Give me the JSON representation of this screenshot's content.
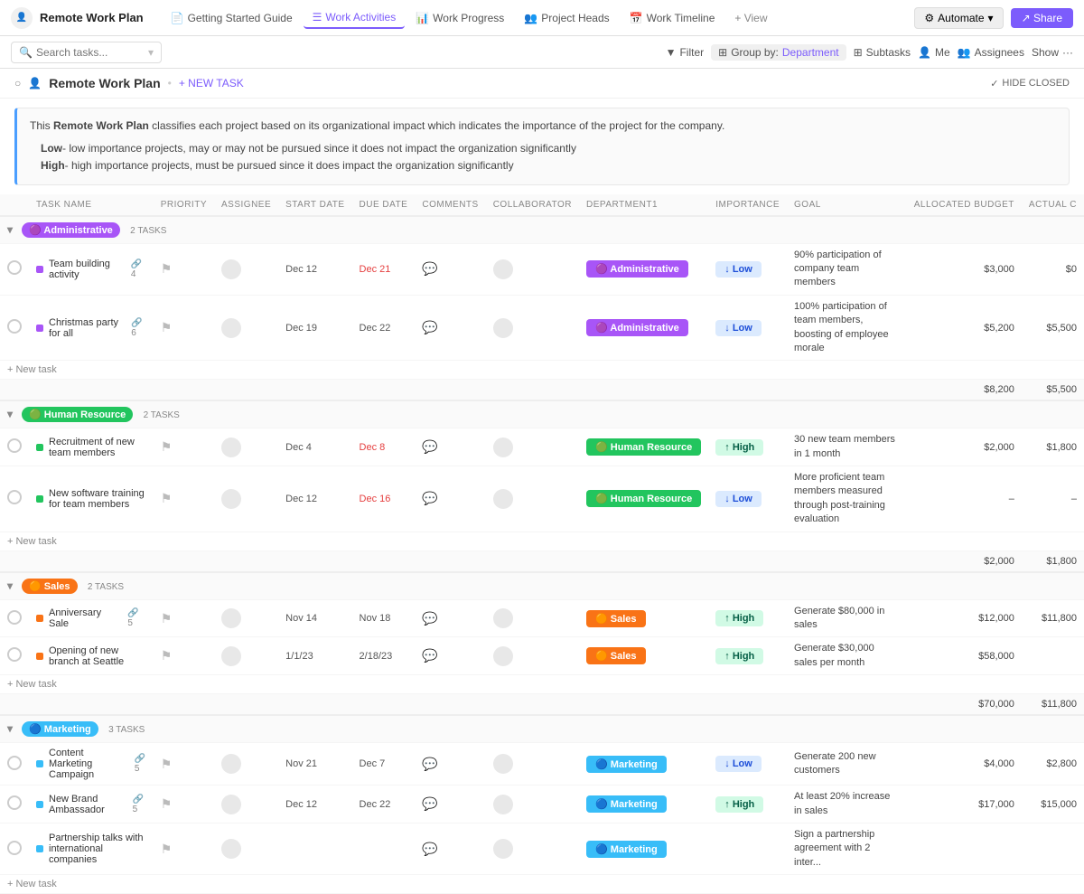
{
  "topBar": {
    "logo": "👤",
    "projectName": "Remote Work Plan",
    "navItems": [
      {
        "id": "getting-started",
        "label": "Getting Started Guide",
        "icon": "📄",
        "active": false
      },
      {
        "id": "work-activities",
        "label": "Work Activities",
        "icon": "☰",
        "active": true
      },
      {
        "id": "work-progress",
        "label": "Work Progress",
        "icon": "📊",
        "active": false
      },
      {
        "id": "project-heads",
        "label": "Project Heads",
        "icon": "👥",
        "active": false
      },
      {
        "id": "work-timeline",
        "label": "Work Timeline",
        "icon": "📅",
        "active": false
      },
      {
        "id": "view",
        "label": "+ View",
        "icon": "",
        "active": false
      }
    ],
    "automate": "Automate",
    "share": "Share"
  },
  "secondBar": {
    "searchPlaceholder": "Search tasks...",
    "filterLabel": "Filter",
    "groupByLabel": "Group by:",
    "groupByValue": "Department",
    "subtasksLabel": "Subtasks",
    "meLabel": "Me",
    "assigneesLabel": "Assignees",
    "showLabel": "Show"
  },
  "projectHeader": {
    "icon": "👤",
    "title": "Remote Work Plan",
    "newTask": "+ NEW TASK",
    "hideClosedCheck": "✓",
    "hideClosed": "HIDE CLOSED"
  },
  "infoBox": {
    "intro": "This ",
    "boldName": "Remote Work Plan",
    "introRest": " classifies each project based on its organizational impact which indicates the importance of the project for the company.",
    "bullets": [
      {
        "label": "Low",
        "text": "- low importance projects, may or may not be pursued since it does not impact the organization significantly"
      },
      {
        "label": "High",
        "text": "- high importance projects, must be pursued since it does impact the organization significantly"
      }
    ]
  },
  "columns": [
    "",
    "TASK NAME",
    "PRIORITY",
    "ASSIGNEE",
    "START DATE",
    "DUE DATE",
    "COMMENTS",
    "COLLABORATOR",
    "DEPARTMENT1",
    "IMPORTANCE",
    "GOAL",
    "ALLOCATED BUDGET",
    "ACTUAL C"
  ],
  "groups": [
    {
      "id": "administrative",
      "label": "Administrative",
      "badgeClass": "badge-admin",
      "taskCount": "2 TASKS",
      "dotClass": "dot-admin",
      "deptBadgeClass": "dept-admin-bg",
      "deptLabel": "Administrative",
      "tasks": [
        {
          "name": "Team building activity",
          "links": 4,
          "priority": "⚑",
          "startDate": "Dec 12",
          "dueDate": "Dec 21",
          "dueDateClass": "date-red",
          "department": "Administrative",
          "importance": "Low",
          "impClass": "imp-low",
          "goal": "90% participation of company team members",
          "budget": "$3,000",
          "actual": "$0"
        },
        {
          "name": "Christmas party for all",
          "links": 6,
          "priority": "⚑",
          "startDate": "Dec 19",
          "dueDate": "Dec 22",
          "dueDateClass": "date-normal",
          "department": "Administrative",
          "importance": "Low",
          "impClass": "imp-low",
          "goal": "100% participation of team members, boosting of employee morale",
          "budget": "$5,200",
          "actual": "$5,500"
        }
      ],
      "totalBudget": "$8,200",
      "totalActual": "$5,500"
    },
    {
      "id": "human-resource",
      "label": "Human Resource",
      "badgeClass": "badge-hr",
      "taskCount": "2 TASKS",
      "dotClass": "dot-hr",
      "deptBadgeClass": "dept-hr-bg",
      "deptLabel": "Human Resource",
      "tasks": [
        {
          "name": "Recruitment of new team members",
          "links": null,
          "priority": "⚑",
          "startDate": "Dec 4",
          "dueDate": "Dec 8",
          "dueDateClass": "date-red",
          "department": "Human Resource",
          "importance": "High",
          "impClass": "imp-high",
          "goal": "30 new team members in 1 month",
          "budget": "$2,000",
          "actual": "$1,800"
        },
        {
          "name": "New software training for team members",
          "links": null,
          "priority": "⚑",
          "startDate": "Dec 12",
          "dueDate": "Dec 16",
          "dueDateClass": "date-red",
          "department": "Human Resource",
          "importance": "Low",
          "impClass": "imp-low",
          "goal": "More proficient team members measured through post-training evaluation",
          "budget": "–",
          "actual": "–"
        }
      ],
      "totalBudget": "$2,000",
      "totalActual": "$1,800"
    },
    {
      "id": "sales",
      "label": "Sales",
      "badgeClass": "badge-sales",
      "taskCount": "2 TASKS",
      "dotClass": "dot-sales",
      "deptBadgeClass": "dept-sales-bg",
      "deptLabel": "Sales",
      "tasks": [
        {
          "name": "Anniversary Sale",
          "links": 5,
          "priority": "⚑",
          "startDate": "Nov 14",
          "dueDate": "Nov 18",
          "dueDateClass": "date-normal",
          "department": "Sales",
          "importance": "High",
          "impClass": "imp-high",
          "goal": "Generate $80,000 in sales",
          "budget": "$12,000",
          "actual": "$11,800"
        },
        {
          "name": "Opening of new branch at Seattle",
          "links": null,
          "priority": "⚑",
          "startDate": "1/1/23",
          "dueDate": "2/18/23",
          "dueDateClass": "date-normal",
          "department": "Sales",
          "importance": "High",
          "impClass": "imp-high",
          "goal": "Generate $30,000 sales per month",
          "budget": "$58,000",
          "actual": ""
        }
      ],
      "totalBudget": "$70,000",
      "totalActual": "$11,800"
    },
    {
      "id": "marketing",
      "label": "Marketing",
      "badgeClass": "badge-marketing",
      "taskCount": "3 TASKS",
      "dotClass": "dot-mkt",
      "deptBadgeClass": "dept-mkt-bg",
      "deptLabel": "Marketing",
      "tasks": [
        {
          "name": "Content Marketing Campaign",
          "links": 5,
          "priority": "⚑",
          "startDate": "Nov 21",
          "dueDate": "Dec 7",
          "dueDateClass": "date-normal",
          "department": "Marketing",
          "importance": "Low",
          "impClass": "imp-low",
          "goal": "Generate 200 new customers",
          "budget": "$4,000",
          "actual": "$2,800"
        },
        {
          "name": "New Brand Ambassador",
          "links": 5,
          "priority": "⚑",
          "startDate": "Dec 12",
          "dueDate": "Dec 22",
          "dueDateClass": "date-normal",
          "department": "Marketing",
          "importance": "High",
          "impClass": "imp-high",
          "goal": "At least 20% increase in sales",
          "budget": "$17,000",
          "actual": "$15,000"
        },
        {
          "name": "Partnership talks with international companies",
          "links": null,
          "priority": "⚑",
          "startDate": "",
          "dueDate": "",
          "dueDateClass": "date-normal",
          "department": "Marketing",
          "importance": "",
          "impClass": "",
          "goal": "Sign a partnership agreement with 2 inter...",
          "budget": "",
          "actual": ""
        }
      ],
      "totalBudget": "",
      "totalActual": ""
    }
  ],
  "icons": {
    "search": "🔍",
    "filter": "▼",
    "chevronDown": "▾",
    "circle": "○",
    "check": "✓",
    "flag": "⚑",
    "comment": "💬",
    "plus": "+",
    "collapse": "▾",
    "deptEmoji": {
      "administrative": "🟣",
      "hr": "🟢",
      "sales": "🟠",
      "marketing": "🔵"
    }
  },
  "colors": {
    "adminPurple": "#a855f7",
    "hrGreen": "#22c55e",
    "salesOrange": "#f97316",
    "marketingBlue": "#38bdf8",
    "accentPurple": "#7c5cfc"
  }
}
